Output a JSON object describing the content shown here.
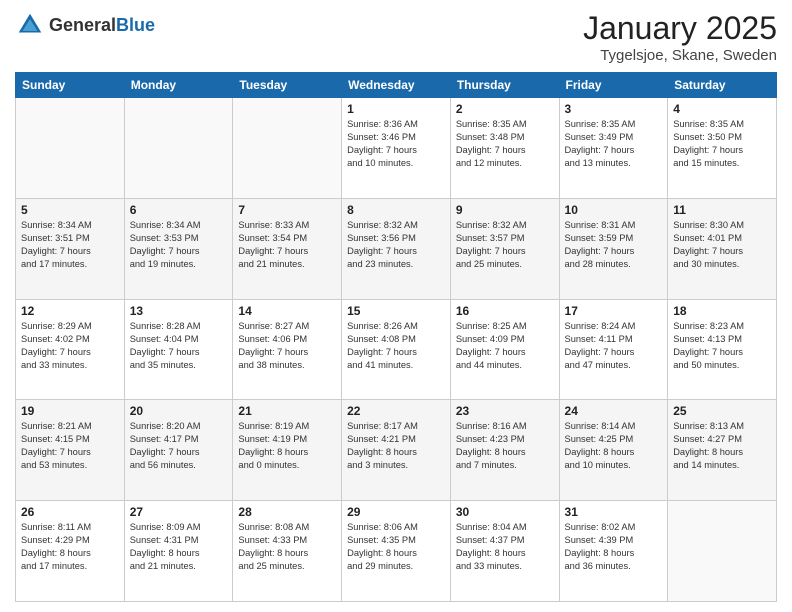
{
  "header": {
    "logo_general": "General",
    "logo_blue": "Blue",
    "title": "January 2025",
    "subtitle": "Tygelsjoe, Skane, Sweden"
  },
  "weekdays": [
    "Sunday",
    "Monday",
    "Tuesday",
    "Wednesday",
    "Thursday",
    "Friday",
    "Saturday"
  ],
  "weeks": [
    [
      {
        "day": "",
        "content": ""
      },
      {
        "day": "",
        "content": ""
      },
      {
        "day": "",
        "content": ""
      },
      {
        "day": "1",
        "content": "Sunrise: 8:36 AM\nSunset: 3:46 PM\nDaylight: 7 hours\nand 10 minutes."
      },
      {
        "day": "2",
        "content": "Sunrise: 8:35 AM\nSunset: 3:48 PM\nDaylight: 7 hours\nand 12 minutes."
      },
      {
        "day": "3",
        "content": "Sunrise: 8:35 AM\nSunset: 3:49 PM\nDaylight: 7 hours\nand 13 minutes."
      },
      {
        "day": "4",
        "content": "Sunrise: 8:35 AM\nSunset: 3:50 PM\nDaylight: 7 hours\nand 15 minutes."
      }
    ],
    [
      {
        "day": "5",
        "content": "Sunrise: 8:34 AM\nSunset: 3:51 PM\nDaylight: 7 hours\nand 17 minutes."
      },
      {
        "day": "6",
        "content": "Sunrise: 8:34 AM\nSunset: 3:53 PM\nDaylight: 7 hours\nand 19 minutes."
      },
      {
        "day": "7",
        "content": "Sunrise: 8:33 AM\nSunset: 3:54 PM\nDaylight: 7 hours\nand 21 minutes."
      },
      {
        "day": "8",
        "content": "Sunrise: 8:32 AM\nSunset: 3:56 PM\nDaylight: 7 hours\nand 23 minutes."
      },
      {
        "day": "9",
        "content": "Sunrise: 8:32 AM\nSunset: 3:57 PM\nDaylight: 7 hours\nand 25 minutes."
      },
      {
        "day": "10",
        "content": "Sunrise: 8:31 AM\nSunset: 3:59 PM\nDaylight: 7 hours\nand 28 minutes."
      },
      {
        "day": "11",
        "content": "Sunrise: 8:30 AM\nSunset: 4:01 PM\nDaylight: 7 hours\nand 30 minutes."
      }
    ],
    [
      {
        "day": "12",
        "content": "Sunrise: 8:29 AM\nSunset: 4:02 PM\nDaylight: 7 hours\nand 33 minutes."
      },
      {
        "day": "13",
        "content": "Sunrise: 8:28 AM\nSunset: 4:04 PM\nDaylight: 7 hours\nand 35 minutes."
      },
      {
        "day": "14",
        "content": "Sunrise: 8:27 AM\nSunset: 4:06 PM\nDaylight: 7 hours\nand 38 minutes."
      },
      {
        "day": "15",
        "content": "Sunrise: 8:26 AM\nSunset: 4:08 PM\nDaylight: 7 hours\nand 41 minutes."
      },
      {
        "day": "16",
        "content": "Sunrise: 8:25 AM\nSunset: 4:09 PM\nDaylight: 7 hours\nand 44 minutes."
      },
      {
        "day": "17",
        "content": "Sunrise: 8:24 AM\nSunset: 4:11 PM\nDaylight: 7 hours\nand 47 minutes."
      },
      {
        "day": "18",
        "content": "Sunrise: 8:23 AM\nSunset: 4:13 PM\nDaylight: 7 hours\nand 50 minutes."
      }
    ],
    [
      {
        "day": "19",
        "content": "Sunrise: 8:21 AM\nSunset: 4:15 PM\nDaylight: 7 hours\nand 53 minutes."
      },
      {
        "day": "20",
        "content": "Sunrise: 8:20 AM\nSunset: 4:17 PM\nDaylight: 7 hours\nand 56 minutes."
      },
      {
        "day": "21",
        "content": "Sunrise: 8:19 AM\nSunset: 4:19 PM\nDaylight: 8 hours\nand 0 minutes."
      },
      {
        "day": "22",
        "content": "Sunrise: 8:17 AM\nSunset: 4:21 PM\nDaylight: 8 hours\nand 3 minutes."
      },
      {
        "day": "23",
        "content": "Sunrise: 8:16 AM\nSunset: 4:23 PM\nDaylight: 8 hours\nand 7 minutes."
      },
      {
        "day": "24",
        "content": "Sunrise: 8:14 AM\nSunset: 4:25 PM\nDaylight: 8 hours\nand 10 minutes."
      },
      {
        "day": "25",
        "content": "Sunrise: 8:13 AM\nSunset: 4:27 PM\nDaylight: 8 hours\nand 14 minutes."
      }
    ],
    [
      {
        "day": "26",
        "content": "Sunrise: 8:11 AM\nSunset: 4:29 PM\nDaylight: 8 hours\nand 17 minutes."
      },
      {
        "day": "27",
        "content": "Sunrise: 8:09 AM\nSunset: 4:31 PM\nDaylight: 8 hours\nand 21 minutes."
      },
      {
        "day": "28",
        "content": "Sunrise: 8:08 AM\nSunset: 4:33 PM\nDaylight: 8 hours\nand 25 minutes."
      },
      {
        "day": "29",
        "content": "Sunrise: 8:06 AM\nSunset: 4:35 PM\nDaylight: 8 hours\nand 29 minutes."
      },
      {
        "day": "30",
        "content": "Sunrise: 8:04 AM\nSunset: 4:37 PM\nDaylight: 8 hours\nand 33 minutes."
      },
      {
        "day": "31",
        "content": "Sunrise: 8:02 AM\nSunset: 4:39 PM\nDaylight: 8 hours\nand 36 minutes."
      },
      {
        "day": "",
        "content": ""
      }
    ]
  ]
}
